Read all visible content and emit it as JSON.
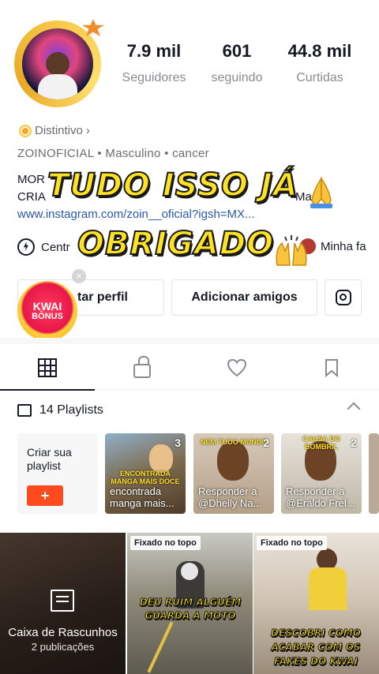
{
  "profile": {
    "stats": [
      {
        "value": "7.9 mil",
        "label": "Seguidores"
      },
      {
        "value": "601",
        "label": "seguindo"
      },
      {
        "value": "44.8 mil",
        "label": "Curtidas"
      }
    ],
    "badge_label": "Distintivo",
    "badge_chevron": "›",
    "meta_line": "ZOINOFICIAL  •  Masculino  •  cancer",
    "bio_line1": "MOR",
    "bio_line2": "CRIA",
    "bio_line2_tail": "Ma",
    "link": "www.instagram.com/zoin__oficial?igsh=MX...",
    "shortcut_left": "Centr",
    "shortcut_right": "Minha fa"
  },
  "overlay": {
    "line1": "TUDO ISSO JÁ",
    "line2": "OBRIGADO"
  },
  "buttons": {
    "edit": "tar perfil",
    "add_friends": "Adicionar amigos"
  },
  "kwai_bonus": {
    "line1": "KWAI",
    "line2": "BÔNUS",
    "close": "×"
  },
  "playlists": {
    "header": "14 Playlists",
    "create_label": "Criar sua playlist",
    "create_plus": "+",
    "items": [
      {
        "count": "3",
        "title": "encontrada manga mais...",
        "caption": "ENCONTRADA MANGA MAIS DOCE"
      },
      {
        "count": "2",
        "title": "Responder a @Dhelly Na...",
        "caption": "NEM TUDO MUNDO"
      },
      {
        "count": "2",
        "title": "Responder a @Eraldo Frel...",
        "caption": "CAUSA DO BOMBRIL"
      }
    ]
  },
  "videos": {
    "draft_title": "Caixa de Rascunhos",
    "draft_sub": "2 publicações",
    "pinned_label": "Fixado no topo",
    "caption_2": "DEU RUIM ALGUÉM GUARDA A MOTO",
    "caption_3": "DESCOBRI COMO ACABAR COM OS FAKES DO KWAI"
  }
}
